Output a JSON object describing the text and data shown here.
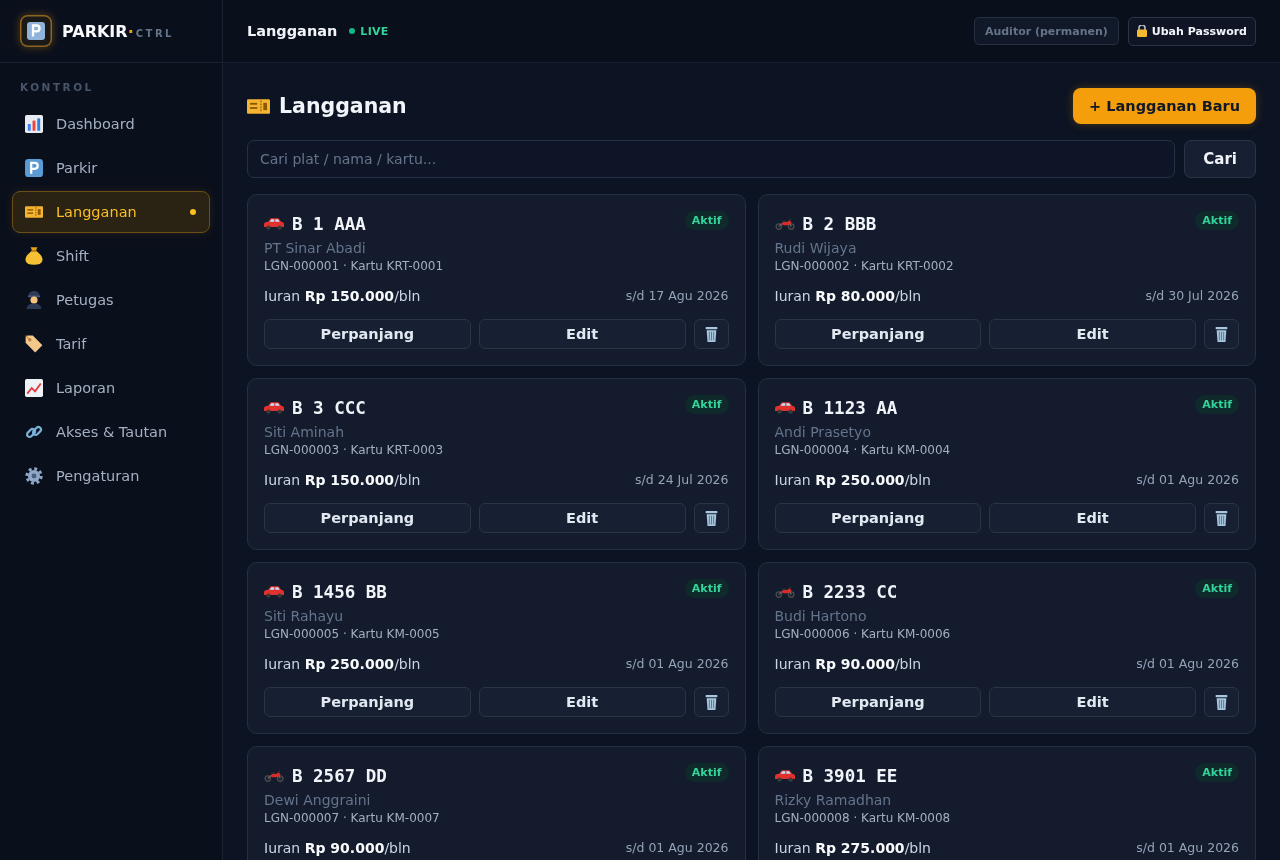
{
  "sidebar": {
    "brand": {
      "name": "PARKIR",
      "separator": "·",
      "suffix": "CTRL"
    },
    "section_label": "KONTROL",
    "items": [
      {
        "label": "Dashboard",
        "selected": false
      },
      {
        "label": "Parkir",
        "selected": false
      },
      {
        "label": "Langganan",
        "selected": true
      },
      {
        "label": "Shift",
        "selected": false
      },
      {
        "label": "Petugas",
        "selected": false
      },
      {
        "label": "Tarif",
        "selected": false
      },
      {
        "label": "Laporan",
        "selected": false
      },
      {
        "label": "Akses & Tautan",
        "selected": false
      },
      {
        "label": "Pengaturan",
        "selected": false
      }
    ]
  },
  "header": {
    "title": "Langganan",
    "live_label": "LIVE",
    "role": "Auditor (permanen)",
    "password_button": "Ubah Password"
  },
  "page": {
    "title": "Langganan",
    "new_button": "+ Langganan Baru",
    "search": {
      "placeholder": "Cari plat / nama / kartu..."
    },
    "search_button": "Cari"
  },
  "subscriptions": [
    {
      "kind": "car",
      "plate": "B 1 AAA",
      "status": "Aktif",
      "name": "PT Sinar Abadi",
      "meta": "LGN-000001 · Kartu KRT-0001",
      "fee": "Iuran **Rp 150.000**/bln",
      "until": "s/d 17 Agu 2026",
      "actions": [
        "Perpanjang",
        "Edit"
      ]
    },
    {
      "kind": "motorcycle",
      "plate": "B 2 BBB",
      "status": "Aktif",
      "name": "Rudi Wijaya",
      "meta": "LGN-000002 · Kartu KRT-0002",
      "fee": "Iuran **Rp 80.000**/bln",
      "until": "s/d 30 Jul 2026",
      "actions": [
        "Perpanjang",
        "Edit"
      ]
    },
    {
      "kind": "car",
      "plate": "B 3 CCC",
      "status": "Aktif",
      "name": "Siti Aminah",
      "meta": "LGN-000003 · Kartu KRT-0003",
      "fee": "Iuran **Rp 150.000**/bln",
      "until": "s/d 24 Jul 2026",
      "actions": [
        "Perpanjang",
        "Edit"
      ]
    },
    {
      "kind": "car",
      "plate": "B 1123 AA",
      "status": "Aktif",
      "name": "Andi Prasetyo",
      "meta": "LGN-000004 · Kartu KM-0004",
      "fee": "Iuran **Rp 250.000**/bln",
      "until": "s/d 01 Agu 2026",
      "actions": [
        "Perpanjang",
        "Edit"
      ]
    },
    {
      "kind": "car",
      "plate": "B 1456 BB",
      "status": "Aktif",
      "name": "Siti Rahayu",
      "meta": "LGN-000005 · Kartu KM-0005",
      "fee": "Iuran **Rp 250.000**/bln",
      "until": "s/d 01 Agu 2026",
      "actions": [
        "Perpanjang",
        "Edit"
      ]
    },
    {
      "kind": "motorcycle",
      "plate": "B 2233 CC",
      "status": "Aktif",
      "name": "Budi Hartono",
      "meta": "LGN-000006 · Kartu KM-0006",
      "fee": "Iuran **Rp 90.000**/bln",
      "until": "s/d 01 Agu 2026",
      "actions": [
        "Perpanjang",
        "Edit"
      ]
    },
    {
      "kind": "motorcycle",
      "plate": "B 2567 DD",
      "status": "Aktif",
      "name": "Dewi Anggraini",
      "meta": "LGN-000007 · Kartu KM-0007",
      "fee": "Iuran **Rp 90.000**/bln",
      "until": "s/d 01 Agu 2026"
    },
    {
      "kind": "car",
      "plate": "B 3901 EE",
      "status": "Aktif",
      "name": "Rizky Ramadhan",
      "meta": "LGN-000008 · Kartu KM-0008",
      "fee": "Iuran **Rp 275.000**/bln",
      "until": "s/d 01 Agu 2026"
    }
  ]
}
